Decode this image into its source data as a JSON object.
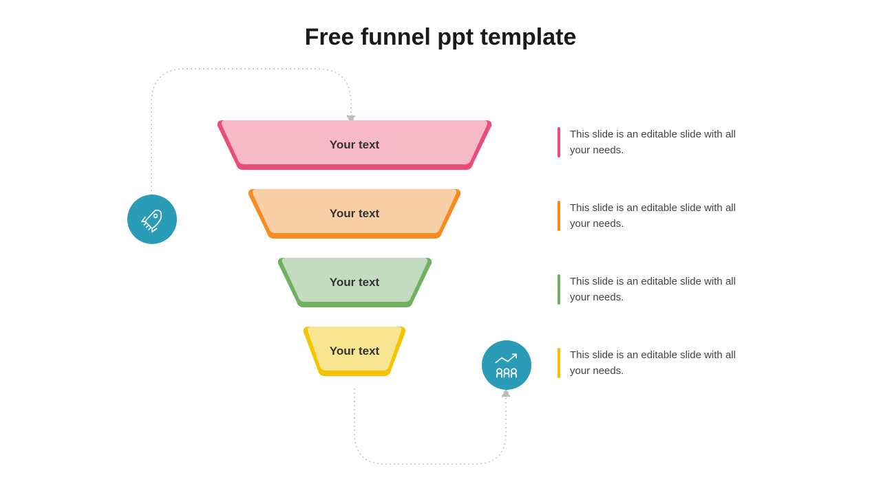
{
  "title": "Free funnel ppt template",
  "funnel": {
    "segments": [
      {
        "label": "Your text",
        "fill": "#f7b9c7",
        "stroke": "#e94d78"
      },
      {
        "label": "Your text",
        "fill": "#f9cfa7",
        "stroke": "#f68b1f"
      },
      {
        "label": "Your text",
        "fill": "#c3dcbf",
        "stroke": "#6fb15f"
      },
      {
        "label": "Your text",
        "fill": "#f9e58f",
        "stroke": "#f3c500"
      }
    ]
  },
  "descriptions": [
    {
      "text": "This slide is an editable slide with all your needs.",
      "color": "#e94d78"
    },
    {
      "text": "This slide is an editable slide with all your needs.",
      "color": "#f68b1f"
    },
    {
      "text": "This slide is an editable slide with all your needs.",
      "color": "#6fb15f"
    },
    {
      "text": "This slide is an editable slide with all your needs.",
      "color": "#f3c500"
    }
  ],
  "icons": {
    "rocket": "rocket-icon",
    "growth": "growth-chart-icon"
  },
  "colors": {
    "circle": "#2b9cb8"
  }
}
